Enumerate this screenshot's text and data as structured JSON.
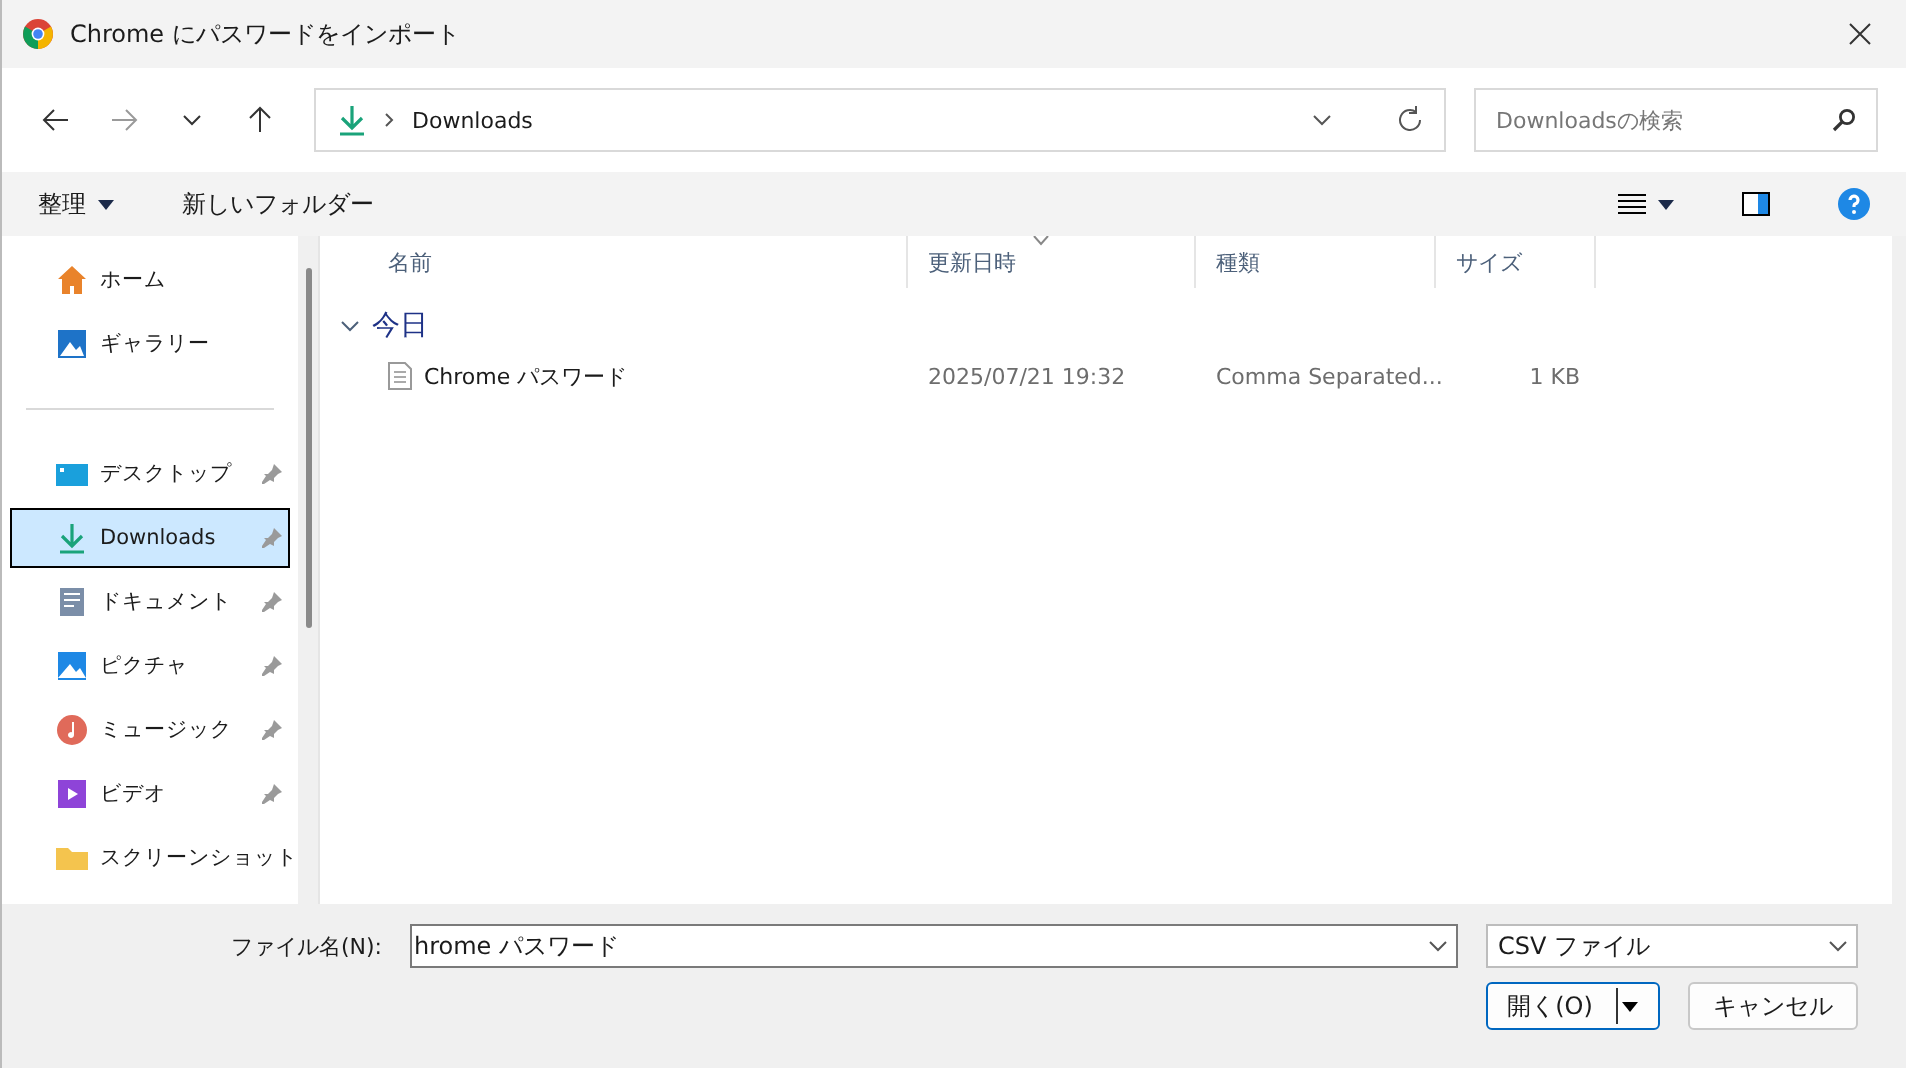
{
  "window": {
    "title": "Chrome にパスワードをインポート"
  },
  "nav": {
    "address": "Downloads",
    "search_placeholder": "Downloadsの検索"
  },
  "toolbar": {
    "organize": "整理",
    "new_folder": "新しいフォルダー"
  },
  "sidebar": {
    "top_items": [
      {
        "kind": "home",
        "label": "ホーム",
        "selected": false
      },
      {
        "kind": "gallery",
        "label": "ギャラリー",
        "selected": false
      }
    ],
    "pinned_items": [
      {
        "kind": "desktop",
        "label": "デスクトップ",
        "selected": false,
        "pinned": true
      },
      {
        "kind": "downloads",
        "label": "Downloads",
        "selected": true,
        "pinned": true
      },
      {
        "kind": "documents",
        "label": "ドキュメント",
        "selected": false,
        "pinned": true
      },
      {
        "kind": "pictures",
        "label": "ピクチャ",
        "selected": false,
        "pinned": true
      },
      {
        "kind": "music",
        "label": "ミュージック",
        "selected": false,
        "pinned": true
      },
      {
        "kind": "videos",
        "label": "ビデオ",
        "selected": false,
        "pinned": true
      },
      {
        "kind": "folder",
        "label": "スクリーンショット",
        "selected": false
      }
    ]
  },
  "table": {
    "columns": [
      {
        "label": "名前",
        "sorted": false
      },
      {
        "label": "更新日時",
        "sorted": true
      },
      {
        "label": "種類",
        "sorted": false
      },
      {
        "label": "サイズ",
        "sorted": false
      }
    ],
    "groups": [
      {
        "label": "今日",
        "expanded": true,
        "rows": [
          {
            "name": "Chrome パスワード",
            "modified": "2025/07/21 19:32",
            "type": "Comma Separated...",
            "size": "1 KB",
            "selected": false
          }
        ]
      }
    ]
  },
  "footer": {
    "filename_label": "ファイル名(N):",
    "filename_value": "hrome パスワード",
    "filetype": "CSV ファイル",
    "open_button": "開く(O)",
    "cancel_button": "キャンセル"
  }
}
